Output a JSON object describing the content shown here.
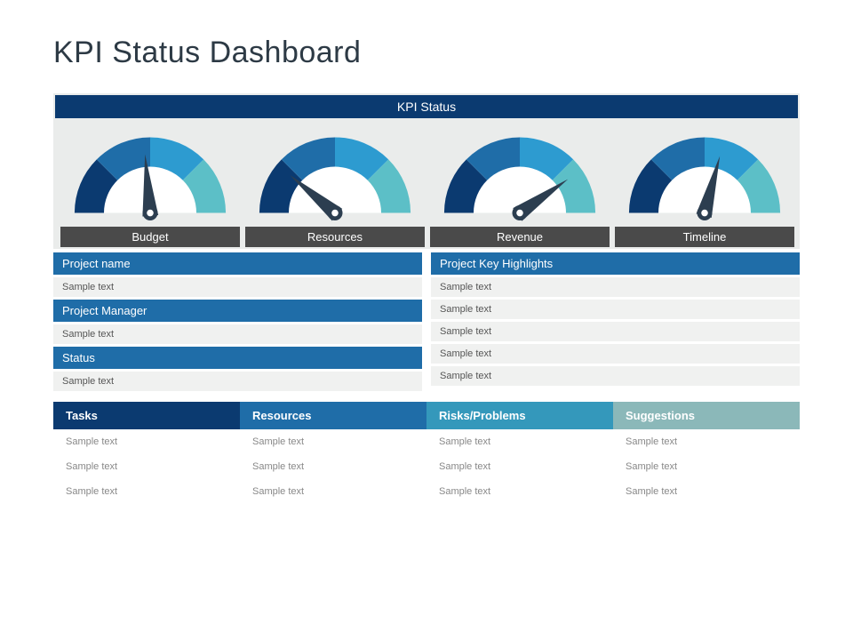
{
  "title": "KPI Status Dashboard",
  "kpi_header": "KPI Status",
  "gauges": [
    {
      "label": "Budget",
      "angle": -5
    },
    {
      "label": "Resources",
      "angle": -50
    },
    {
      "label": "Revenue",
      "angle": 55
    },
    {
      "label": "Timeline",
      "angle": 15
    }
  ],
  "left_sections": [
    {
      "title": "Project name",
      "rows": [
        "Sample text"
      ]
    },
    {
      "title": "Project Manager",
      "rows": [
        "Sample text"
      ]
    },
    {
      "title": "Status",
      "rows": [
        "Sample text"
      ]
    }
  ],
  "right_section": {
    "title": "Project Key Highlights",
    "rows": [
      "Sample text",
      "Sample text",
      "Sample text",
      "Sample text",
      "Sample text"
    ]
  },
  "table": {
    "headers": [
      "Tasks",
      "Resources",
      "Risks/Problems",
      "Suggestions"
    ],
    "rows": [
      [
        "Sample text",
        "Sample text",
        "Sample text",
        "Sample text"
      ],
      [
        "Sample text",
        "Sample text",
        "Sample text",
        "Sample text"
      ],
      [
        "Sample text",
        "Sample text",
        "Sample text",
        "Sample text"
      ]
    ]
  },
  "colors": {
    "seg1": "#0b3a70",
    "seg2": "#1f6da8",
    "seg3": "#2d9bd0",
    "seg4": "#5cbfc7",
    "needle": "#2c3e50"
  }
}
